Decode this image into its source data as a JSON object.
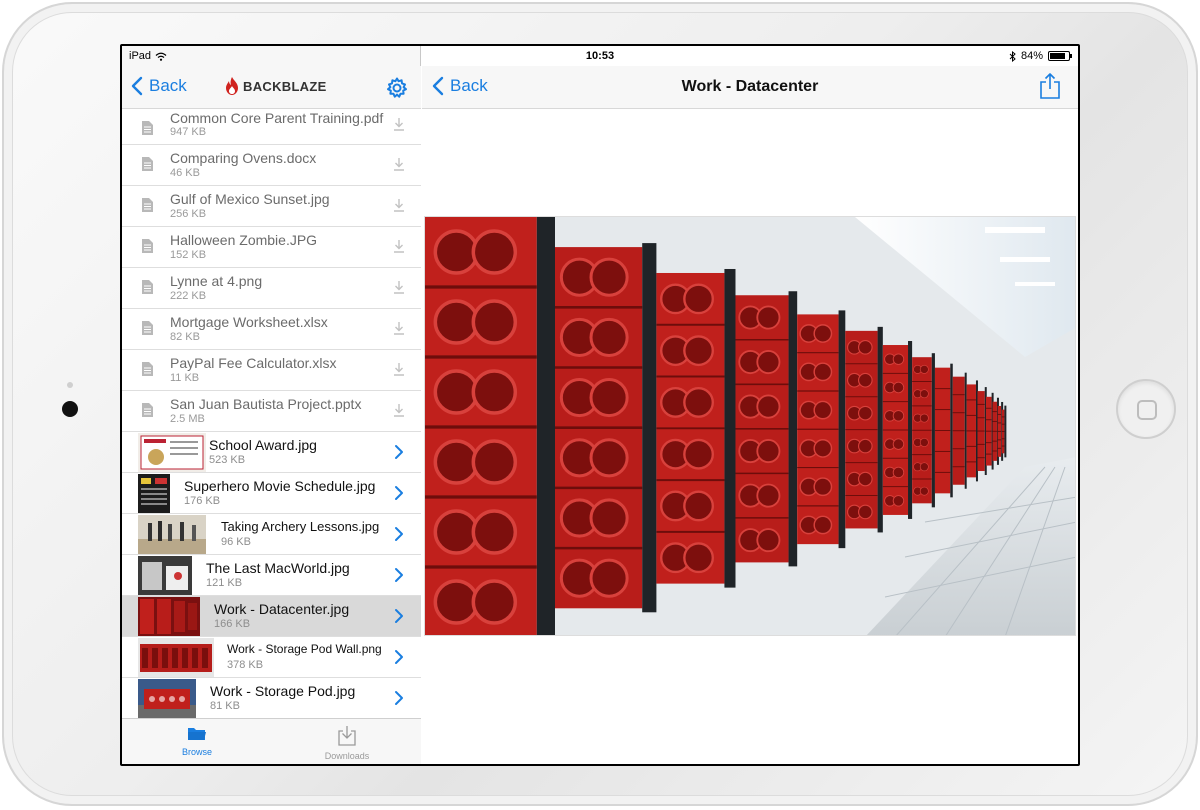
{
  "status_bar": {
    "device": "iPad",
    "time": "10:53",
    "battery": "84%",
    "battery_level": 0.84
  },
  "left_nav": {
    "back_label": "Back",
    "brand": "BACKBLAZE"
  },
  "files": [
    {
      "name": "Common Core Parent Training.pdf",
      "size": "947 KB"
    },
    {
      "name": "Comparing Ovens.docx",
      "size": "46 KB"
    },
    {
      "name": "Gulf of Mexico Sunset.jpg",
      "size": "256 KB"
    },
    {
      "name": "Halloween Zombie.JPG",
      "size": "152 KB"
    },
    {
      "name": "Lynne at 4.png",
      "size": "222 KB"
    },
    {
      "name": "Mortgage Worksheet.xlsx",
      "size": "82 KB"
    },
    {
      "name": "PayPal Fee Calculator.xlsx",
      "size": "11 KB"
    },
    {
      "name": "San Juan Bautista Project.pptx",
      "size": "2.5 MB"
    }
  ],
  "images": [
    {
      "name": "School Award.jpg",
      "size": "523 KB"
    },
    {
      "name": "Superhero Movie Schedule.jpg",
      "size": "176 KB"
    },
    {
      "name": "Taking Archery Lessons.jpg",
      "size": "96 KB"
    },
    {
      "name": "The Last MacWorld.jpg",
      "size": "121 KB"
    },
    {
      "name": "Work - Datacenter.jpg",
      "size": "166 KB"
    },
    {
      "name": "Work - Storage Pod Wall.png",
      "size": "378 KB"
    },
    {
      "name": "Work - Storage Pod.jpg",
      "size": "81 KB"
    }
  ],
  "tabs": [
    {
      "label": "Browse"
    },
    {
      "label": "Downloads"
    }
  ],
  "right_nav": {
    "back_label": "Back",
    "title": "Work - Datacenter"
  },
  "colors": {
    "accent": "#1a7ee0",
    "rack_red": "#c0201c"
  }
}
